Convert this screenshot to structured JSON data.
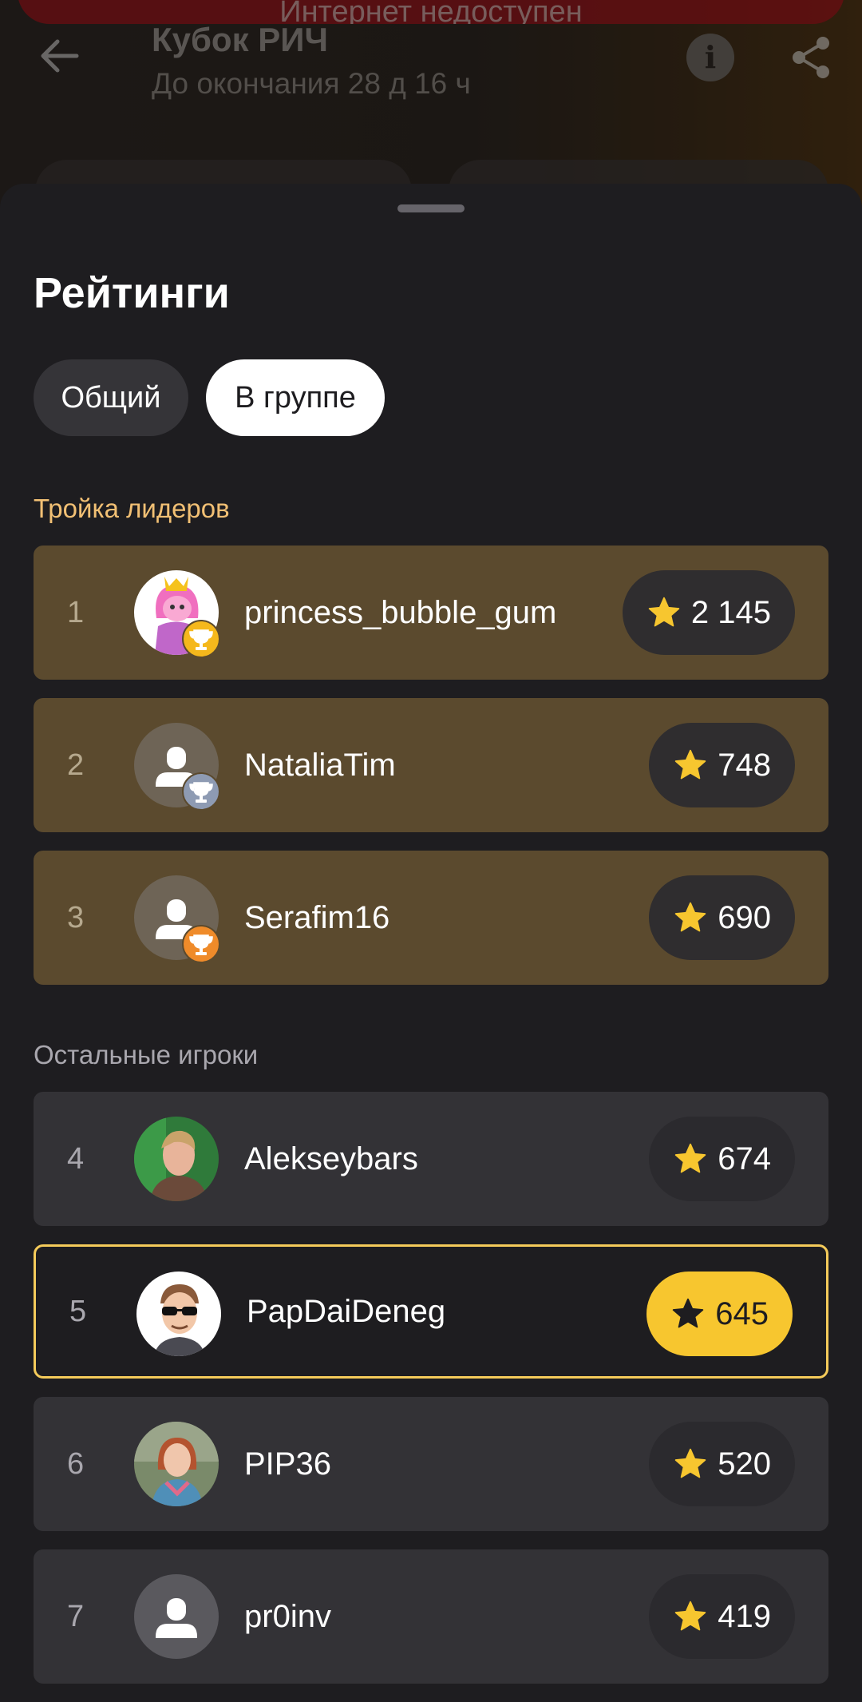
{
  "app": {
    "offline_banner": "Интернет недоступен",
    "title": "Кубок РИЧ",
    "subtitle": "До окончания 28 д 16 ч"
  },
  "sheet": {
    "title": "Рейтинги",
    "tabs": [
      {
        "label": "Общий",
        "selected": false
      },
      {
        "label": "В группе",
        "selected": true
      }
    ],
    "leaders_label": "Тройка лидеров",
    "others_label": "Остальные игроки"
  },
  "leaders": [
    {
      "rank": "1",
      "name": "princess_bubble_gum",
      "score": "2 145",
      "avatar": "cartoon-princess-avatar",
      "trophy": "gold"
    },
    {
      "rank": "2",
      "name": "NataliaTim",
      "score": "748",
      "avatar": "default-user-avatar",
      "trophy": "silver"
    },
    {
      "rank": "3",
      "name": "Serafim16",
      "score": "690",
      "avatar": "default-user-avatar",
      "trophy": "bronze"
    }
  ],
  "others": [
    {
      "rank": "4",
      "name": "Alekseybars",
      "score": "674",
      "avatar": "photo-avatar",
      "current_user": false
    },
    {
      "rank": "5",
      "name": "PapDaiDeneg",
      "score": "645",
      "avatar": "cartoon-sunglasses-avatar",
      "current_user": true
    },
    {
      "rank": "6",
      "name": "PIP36",
      "score": "520",
      "avatar": "photo-avatar",
      "current_user": false
    },
    {
      "rank": "7",
      "name": "pr0inv",
      "score": "419",
      "avatar": "default-user-avatar",
      "current_user": false
    }
  ],
  "colors": {
    "accent": "#f7c62f",
    "leader_row": "#5b4a2e",
    "leaders_label": "#f2c074",
    "gold": "#f5b81c",
    "silver": "#8e9bb3",
    "bronze": "#ef8b2a"
  }
}
